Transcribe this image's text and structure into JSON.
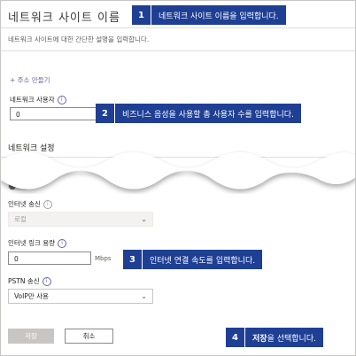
{
  "form": {
    "title": "네트워크 사이트 이름",
    "description": "네트워크 사이트에 대한 간단한 설명을 입력합니다.",
    "add_address_link": "+ 주소 만들기",
    "users_label": "네트워크 사용자",
    "users_value": "0",
    "network_settings_heading": "네트워크 설정",
    "internet_egress_label": "인터넷 송신",
    "internet_egress_value": "로컬",
    "internet_link_capacity_label": "인터넷 링크 용량",
    "internet_link_capacity_value": "0",
    "internet_link_capacity_unit": "Mbps",
    "pstn_egress_label": "PSTN 송신",
    "pstn_egress_value": "VoIP만 사용",
    "save_label": "저장",
    "cancel_label": "취소",
    "info_glyph": "i"
  },
  "callouts": [
    {
      "number": "1",
      "text": "네트워크 사이트 이름을 입력합니다."
    },
    {
      "number": "2",
      "text": "비즈니스 음성을 사용할 총 사용자 수를 입력합니다."
    },
    {
      "number": "3",
      "text": "인터넷 연결 속도를 입력합니다."
    },
    {
      "number": "4",
      "text_bold": "저장",
      "text_rest": "을 선택합니다."
    }
  ],
  "colors": {
    "callout_bg": "#1f3f94",
    "accent": "#6264a7",
    "disabled_button": "#c8c6c4"
  },
  "icons": {
    "info": "info-circle-icon",
    "chevron": "chevron-down-icon"
  }
}
